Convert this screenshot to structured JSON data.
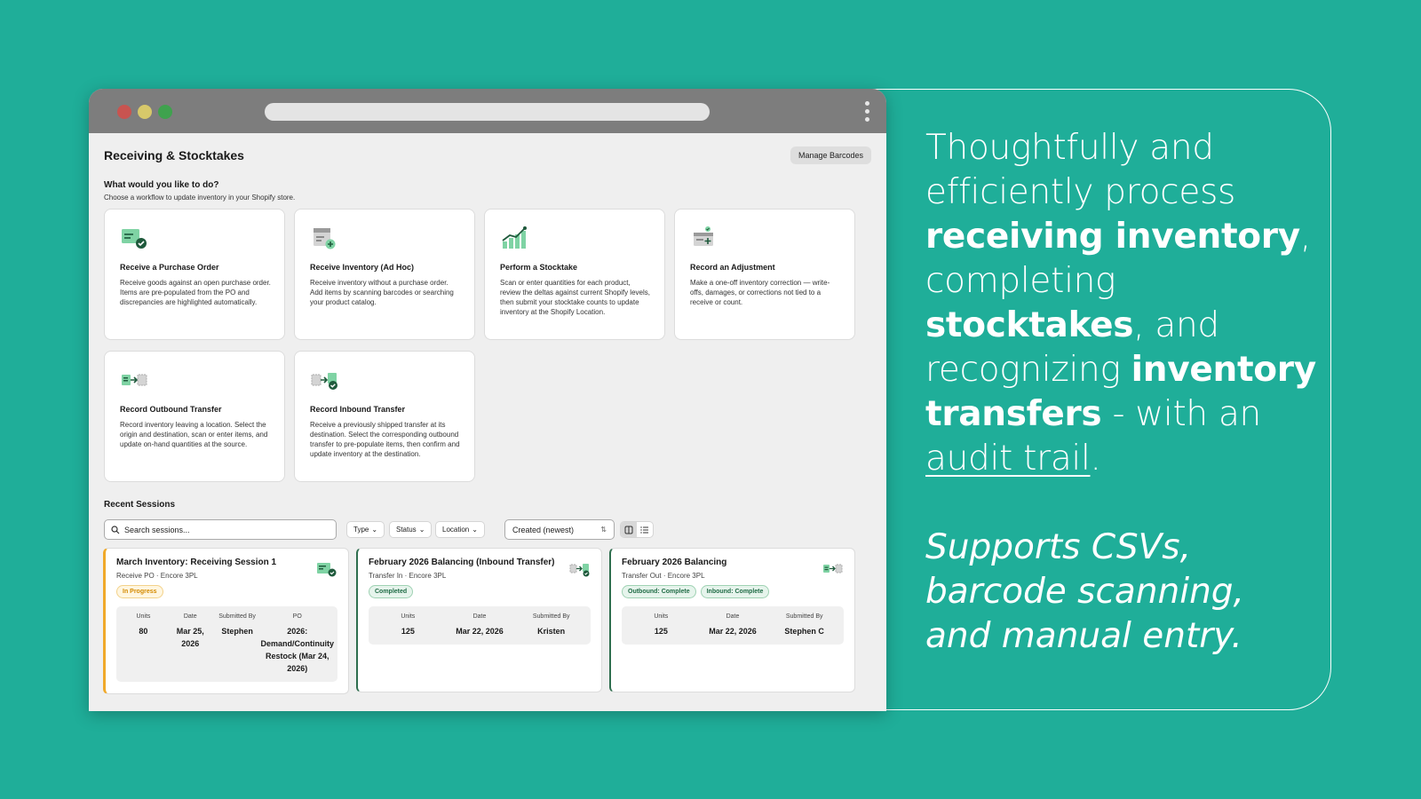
{
  "window": {
    "title": "Receiving & Stocktakes",
    "manage_label": "Manage Barcodes"
  },
  "intro": {
    "question": "What would you like to do?",
    "subtitle": "Choose a workflow to update inventory in your Shopify store."
  },
  "workflows": [
    {
      "icon": "receive-po-icon",
      "title": "Receive a Purchase Order",
      "desc": "Receive goods against an open purchase order. Items are pre-populated from the PO and discrepancies are highlighted automatically."
    },
    {
      "icon": "receive-adhoc-icon",
      "title": "Receive Inventory (Ad Hoc)",
      "desc": "Receive inventory without a purchase order. Add items by scanning barcodes or searching your product catalog."
    },
    {
      "icon": "stocktake-chart-icon",
      "title": "Perform a Stocktake",
      "desc": "Scan or enter quantities for each product, review the deltas against current Shopify levels, then submit your stocktake counts to update inventory at the Shopify Location."
    },
    {
      "icon": "adjustment-icon",
      "title": "Record an Adjustment",
      "desc": "Make a one-off inventory correction — write-offs, damages, or corrections not tied to a receive or count."
    },
    {
      "icon": "outbound-transfer-icon",
      "title": "Record Outbound Transfer",
      "desc": "Record inventory leaving a location. Select the origin and destination, scan or enter items, and update on-hand quantities at the source."
    },
    {
      "icon": "inbound-transfer-icon",
      "title": "Record Inbound Transfer",
      "desc": "Receive a previously shipped transfer at its destination. Select the corresponding outbound transfer to pre-populate items, then confirm and update inventory at the destination."
    }
  ],
  "recent": {
    "title": "Recent Sessions",
    "search_placeholder": "Search sessions...",
    "filters": [
      "Type",
      "Status",
      "Location"
    ],
    "sort": "Created (newest)"
  },
  "sessions": [
    {
      "title": "March Inventory: Receiving Session 1",
      "sub": "Receive PO · Encore 3PL",
      "badges": [
        "In Progress"
      ],
      "stats": [
        {
          "label": "Units",
          "value": "80"
        },
        {
          "label": "Date",
          "value": "Mar 25, 2026"
        },
        {
          "label": "Submitted By",
          "value": "Stephen"
        },
        {
          "label": "PO",
          "value": "2026: Demand/Continuity Restock (Mar 24, 2026)"
        }
      ]
    },
    {
      "title": "February 2026 Balancing (Inbound Transfer)",
      "sub": "Transfer In · Encore 3PL",
      "badges": [
        "Completed"
      ],
      "stats": [
        {
          "label": "Units",
          "value": "125"
        },
        {
          "label": "Date",
          "value": "Mar 22, 2026"
        },
        {
          "label": "Submitted By",
          "value": "Kristen"
        }
      ]
    },
    {
      "title": "February 2026 Balancing",
      "sub": "Transfer Out · Encore 3PL",
      "badges": [
        "Outbound: Complete",
        "Inbound: Complete"
      ],
      "stats": [
        {
          "label": "Units",
          "value": "125"
        },
        {
          "label": "Date",
          "value": "Mar 22, 2026"
        },
        {
          "label": "Submitted By",
          "value": "Stephen C"
        }
      ]
    }
  ],
  "promo": {
    "t1": "Thoughtfully and efficiently process ",
    "b1": "receiving inventory",
    "t2": ", completing ",
    "b2": "stocktakes",
    "t3": ", and recognizing ",
    "b3": "inventory transfers",
    "t4": " - with an ",
    "u1": "audit trail",
    "t5": ".",
    "sub": "Supports CSVs, barcode scanning, and manual entry."
  },
  "colors": {
    "background": "#1fae99",
    "accent_green": "#2e6e4e",
    "in_progress": "#f0a92a"
  }
}
